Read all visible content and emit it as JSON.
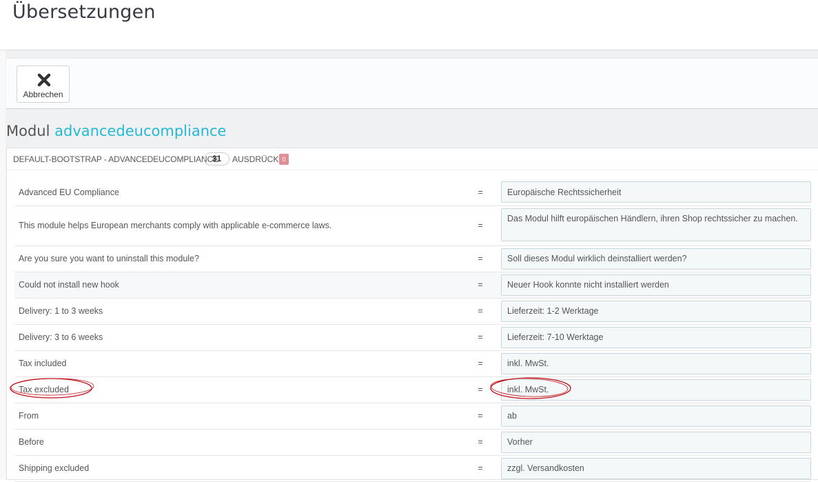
{
  "page_title": "Übersetzungen",
  "toolbar": {
    "cancel_label": "Abbrechen",
    "cancel_icon": "close-icon"
  },
  "module": {
    "prefix": "Modul",
    "name": "advancedeucompliance"
  },
  "panel": {
    "heading": "DEFAULT-BOOTSTRAP - ADVANCEDEUCOMPLIANCE",
    "count": "31",
    "expressions_label": "AUSDRÜCKE",
    "missing_count": "0"
  },
  "rows": [
    {
      "source": "Advanced EU Compliance",
      "eq": "=",
      "value": "Europäische Rechtssicherheit"
    },
    {
      "source": "This module helps European merchants comply with applicable e-commerce laws.",
      "eq": "=",
      "value": "Das Modul hilft europäischen Händlern, ihren Shop rechtssicher zu machen."
    },
    {
      "source": "Are you sure you want to uninstall this module?",
      "eq": "=",
      "value": "Soll dieses Modul wirklich deinstalliert werden?"
    },
    {
      "source": "Could not install new hook",
      "eq": "=",
      "value": "Neuer Hook konnte nicht installiert werden"
    },
    {
      "source": "Delivery: 1 to 3 weeks",
      "eq": "=",
      "value": "Lieferzeit: 1-2 Werktage"
    },
    {
      "source": "Delivery: 3 to 6 weeks",
      "eq": "=",
      "value": "Lieferzeit: 7-10 Werktage"
    },
    {
      "source": "Tax included",
      "eq": "=",
      "value": "inkl. MwSt."
    },
    {
      "source": "Tax excluded",
      "eq": "=",
      "value": "inkl. MwSt."
    },
    {
      "source": "From",
      "eq": "=",
      "value": "ab"
    },
    {
      "source": "Before",
      "eq": "=",
      "value": "Vorher"
    },
    {
      "source": "Shipping excluded",
      "eq": "=",
      "value": "zzgl. Versandkosten"
    }
  ],
  "colors": {
    "accent": "#25b9d7",
    "annotation": "#c0111a",
    "badge": "#e08f95"
  }
}
